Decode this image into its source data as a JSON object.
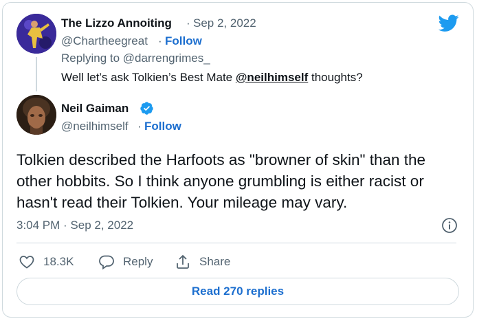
{
  "reply_tweet": {
    "author_name": "The Lizzo Annoiting",
    "date_sep": "·",
    "date": "Sep 2, 2022",
    "handle": "@Chartheegreat",
    "handle_sep": "·",
    "follow_label": "Follow",
    "replying_to_prefix": "Replying to ",
    "replying_to_handle": "@darrengrimes_",
    "text_before": "Well let’s ask Tolkien’s Best Mate ",
    "mention": "@neilhimself",
    "text_after": " thoughts?",
    "avatar_icon": "person-avatar"
  },
  "main_tweet": {
    "author_name": "Neil Gaiman",
    "verified_icon": "verified-badge-icon",
    "handle": "@neilhimself",
    "handle_sep": "·",
    "follow_label": "Follow",
    "text": "Tolkien described the Harfoots as \"browner of skin\" than the other hobbits. So I think anyone grumbling is either racist or hasn't read their Tolkien. Your mileage may vary.",
    "timestamp": "3:04 PM · Sep 2, 2022",
    "avatar_icon": "person-avatar"
  },
  "actions": {
    "like_count": "18.3K",
    "reply_label": "Reply",
    "share_label": "Share"
  },
  "read_replies_label": "Read 270 replies",
  "colors": {
    "accent": "#1d6fcf",
    "twitter_blue": "#1d9bf0",
    "muted": "#536471",
    "border": "#cfd9de",
    "text": "#0f1419"
  },
  "icons": [
    "twitter-bird-icon",
    "info-icon",
    "heart-icon",
    "reply-icon",
    "share-icon"
  ]
}
